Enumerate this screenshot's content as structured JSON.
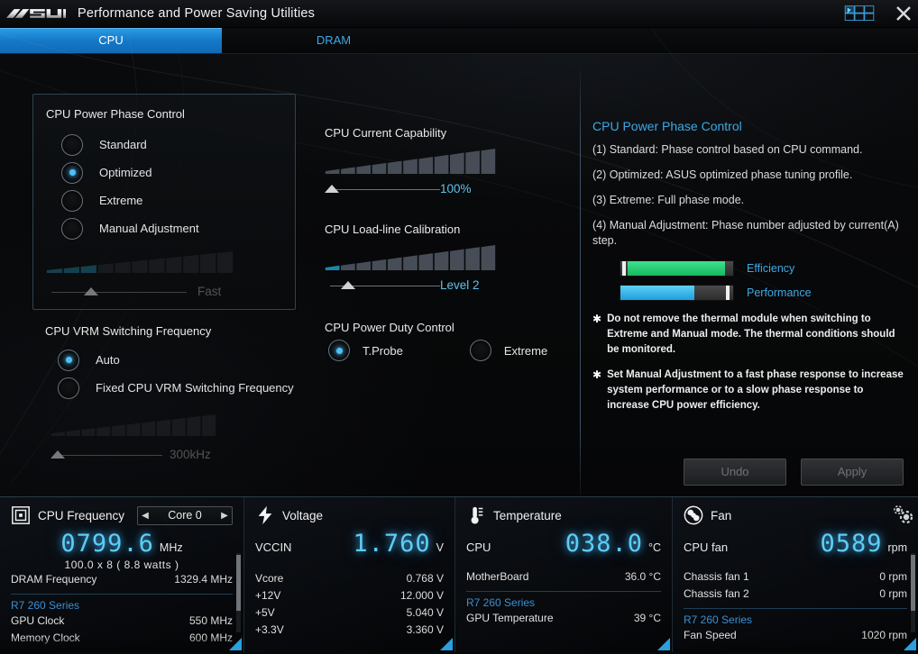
{
  "window": {
    "brand": "ASUS",
    "title": "Performance and Power Saving Utilities",
    "close_label": "✕",
    "grid_icon": "app-grid-icon"
  },
  "tabs": [
    {
      "label": "CPU",
      "active": true
    },
    {
      "label": "DRAM",
      "active": false
    }
  ],
  "phase_control": {
    "title": "CPU Power Phase Control",
    "options": [
      {
        "label": "Standard",
        "selected": false
      },
      {
        "label": "Optimized",
        "selected": true
      },
      {
        "label": "Extreme",
        "selected": false
      },
      {
        "label": "Manual Adjustment",
        "selected": false
      }
    ],
    "slider": {
      "value_label": "Fast",
      "filled_steps": 3,
      "total_steps": 11,
      "thumb_pct": 27,
      "disabled": true
    }
  },
  "vrm": {
    "title": "CPU VRM Switching Frequency",
    "options": [
      {
        "label": "Auto",
        "selected": true
      },
      {
        "label": "Fixed CPU VRM Switching Frequency",
        "selected": false
      }
    ],
    "slider": {
      "value_label": "300kHz",
      "filled_steps": 0,
      "total_steps": 11,
      "thumb_pct": 2,
      "disabled": true
    }
  },
  "current_capability": {
    "title": "CPU Current Capability",
    "slider": {
      "value_label": "100%",
      "filled_steps": 0,
      "total_steps": 11,
      "thumb_pct": 2,
      "disabled": false
    }
  },
  "loadline": {
    "title": "CPU Load-line Calibration",
    "slider": {
      "value_label": "Level 2",
      "filled_steps": 1,
      "total_steps": 11,
      "thumb_pct": 13,
      "disabled": false
    }
  },
  "duty_control": {
    "title": "CPU Power Duty Control",
    "options": [
      {
        "label": "T.Probe",
        "selected": true
      },
      {
        "label": "Extreme",
        "selected": false
      }
    ]
  },
  "help": {
    "title": "CPU Power Phase Control",
    "paragraphs": [
      "(1) Standard: Phase control based on CPU command.",
      "(2) Optimized: ASUS optimized phase tuning profile.",
      "(3) Extreme: Full phase mode.",
      "(4) Manual Adjustment: Phase number adjusted by current(A) step."
    ],
    "meters": [
      {
        "label": "Efficiency",
        "percent": 96,
        "color": "#20c86a",
        "cap_position": "left"
      },
      {
        "label": "Performance",
        "percent": 66,
        "color": "#2aa8e2",
        "cap_position": "right"
      }
    ],
    "notes": [
      "Do not remove the thermal module when switching to Extreme and Manual mode. The thermal conditions should be monitored.",
      "Set Manual Adjustment to a fast phase response to increase system performance or to a slow phase response to increase CPU power efficiency."
    ],
    "star": "✱"
  },
  "actions": {
    "undo_label": "Undo",
    "apply_label": "Apply"
  },
  "monitor": {
    "cpu_frequency": {
      "icon": "cpu-chip-icon",
      "title": "CPU Frequency",
      "core_selector": {
        "value": "Core 0",
        "prev": "◀",
        "next": "▶"
      },
      "big_value": "0799.6",
      "big_unit": "MHz",
      "sub_line": "100.0  x 8    ( 8.8     watts )",
      "rows": [
        {
          "label": "DRAM Frequency",
          "value": "1329.4  MHz"
        }
      ],
      "gpu_group": "R7 260 Series",
      "gpu_rows": [
        {
          "label": "GPU Clock",
          "value": "550 MHz"
        },
        {
          "label": "Memory Clock",
          "value": "600 MHz"
        }
      ]
    },
    "voltage": {
      "icon": "bolt-icon",
      "title": "Voltage",
      "big_label": "VCCIN",
      "big_value": "1.760",
      "big_unit": "V",
      "rows": [
        {
          "label": "Vcore",
          "value": "0.768  V"
        },
        {
          "label": "+12V",
          "value": "12.000  V"
        },
        {
          "label": "+5V",
          "value": "5.040  V"
        },
        {
          "label": "+3.3V",
          "value": "3.360  V"
        }
      ]
    },
    "temperature": {
      "icon": "thermometer-icon",
      "title": "Temperature",
      "big_label": "CPU",
      "big_value": "038.0",
      "big_unit": "°C",
      "rows": [
        {
          "label": "MotherBoard",
          "value": "36.0 °C"
        }
      ],
      "gpu_group": "R7 260 Series",
      "gpu_rows": [
        {
          "label": "GPU Temperature",
          "value": "39 °C"
        }
      ]
    },
    "fan": {
      "icon": "fan-icon",
      "title": "Fan",
      "big_label": "CPU fan",
      "big_value": "0589",
      "big_unit": "rpm",
      "rows": [
        {
          "label": "Chassis fan 1",
          "value": "0  rpm"
        },
        {
          "label": "Chassis fan 2",
          "value": "0  rpm"
        }
      ],
      "gpu_group": "R7 260 Series",
      "gpu_rows": [
        {
          "label": "Fan Speed",
          "value": "1020 rpm"
        }
      ],
      "settings_icon": "gear-icon"
    }
  }
}
